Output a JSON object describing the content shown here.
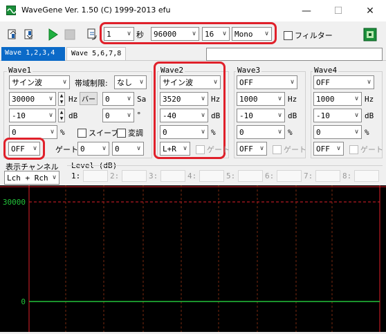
{
  "window": {
    "title": "WaveGene  Ver. 1.50  (C) 1999-2013 efu",
    "minimize": "—",
    "maximize": "☐",
    "close": "✕"
  },
  "toolbar": {
    "duration": "1",
    "duration_unit": "秒",
    "sample_rate": "96000",
    "bits": "16",
    "channels": "Mono",
    "filter_label": "フィルター"
  },
  "tabs": [
    {
      "label": "Wave 1,2,3,4"
    },
    {
      "label": "Wave 5,6,7,8"
    }
  ],
  "wave1": {
    "title": "Wave1",
    "waveform": "サイン波",
    "band_label": "帯域制限:",
    "band_value": "なし",
    "freq": "30000",
    "freq_unit": "Hz",
    "bar_label": "バー",
    "bar_value": "0",
    "bar_unit": "Sa",
    "level": "-10",
    "level_unit": "dB",
    "phase": "0",
    "phase_unit": "°",
    "offset": "0",
    "offset_unit": "%",
    "sweep_label": "スイープ",
    "modulate_label": "変調",
    "output": "OFF",
    "gate_label": "ゲート:",
    "gate1": "0",
    "gate2": "0"
  },
  "wave2": {
    "title": "Wave2",
    "waveform": "サイン波",
    "freq": "3520",
    "freq_unit": "Hz",
    "level": "-40",
    "level_unit": "dB",
    "offset": "0",
    "offset_unit": "%",
    "output": "L+R",
    "gate_label": "ゲート"
  },
  "wave3": {
    "title": "Wave3",
    "waveform": "OFF",
    "freq": "1000",
    "freq_unit": "Hz",
    "level": "-10",
    "level_unit": "dB",
    "offset": "0",
    "offset_unit": "%",
    "output": "OFF",
    "gate_label": "ゲート"
  },
  "wave4": {
    "title": "Wave4",
    "waveform": "OFF",
    "freq": "1000",
    "freq_unit": "Hz",
    "level": "-10",
    "level_unit": "dB",
    "offset": "0",
    "offset_unit": "%",
    "output": "OFF",
    "gate_label": "ゲート"
  },
  "display": {
    "label": "表示チャンネル",
    "value": "Lch + Rch"
  },
  "levels": {
    "title": "Level (dB)",
    "labels": [
      "1:",
      "2:",
      "3:",
      "4:",
      "5:",
      "6:",
      "7:",
      "8:"
    ]
  },
  "scope": {
    "ytop": "30000",
    "yzero": "0",
    "colors": {
      "bg": "#000000",
      "frame": "#e0202a",
      "signal": "#22c33a",
      "grid": "#7a2a10"
    }
  }
}
